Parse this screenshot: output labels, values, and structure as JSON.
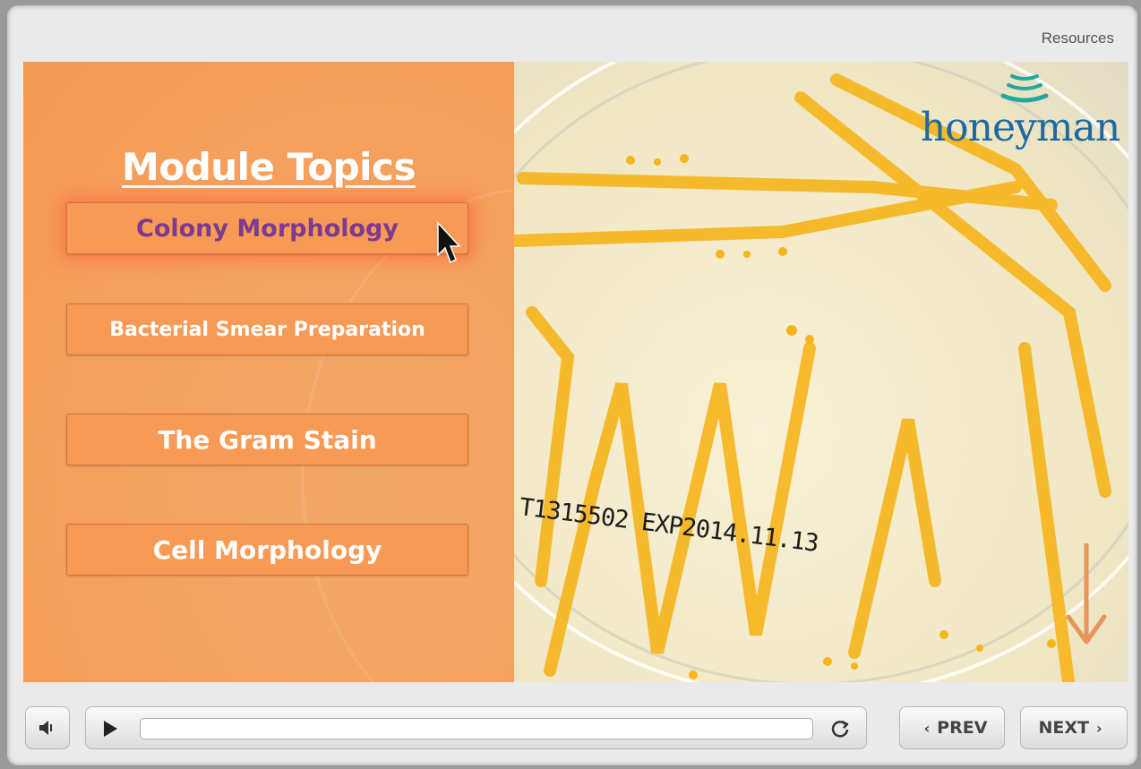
{
  "header": {
    "resources_label": "Resources"
  },
  "slide": {
    "title": "Module Topics",
    "topics": [
      {
        "label": "Colony Morphology",
        "active": true
      },
      {
        "label": "Bacterial Smear Preparation",
        "active": false
      },
      {
        "label": "The Gram Stain",
        "active": false
      },
      {
        "label": "Cell Morphology",
        "active": false
      }
    ],
    "logo_text": "honeyman",
    "lot_label": "T1315502 EXP2014.11.13",
    "colors": {
      "panel_orange": "#f5a05c",
      "active_text": "#7d3a8e",
      "logo_blue": "#1e6aa0"
    }
  },
  "controls": {
    "prev_label": "PREV",
    "next_label": "NEXT",
    "progress": 0
  },
  "icons": [
    "volume-icon",
    "play-icon",
    "replay-icon",
    "chevron-left-icon",
    "chevron-right-icon",
    "mouse-cursor-icon",
    "down-arrow-icon",
    "wave-logo-icon"
  ]
}
